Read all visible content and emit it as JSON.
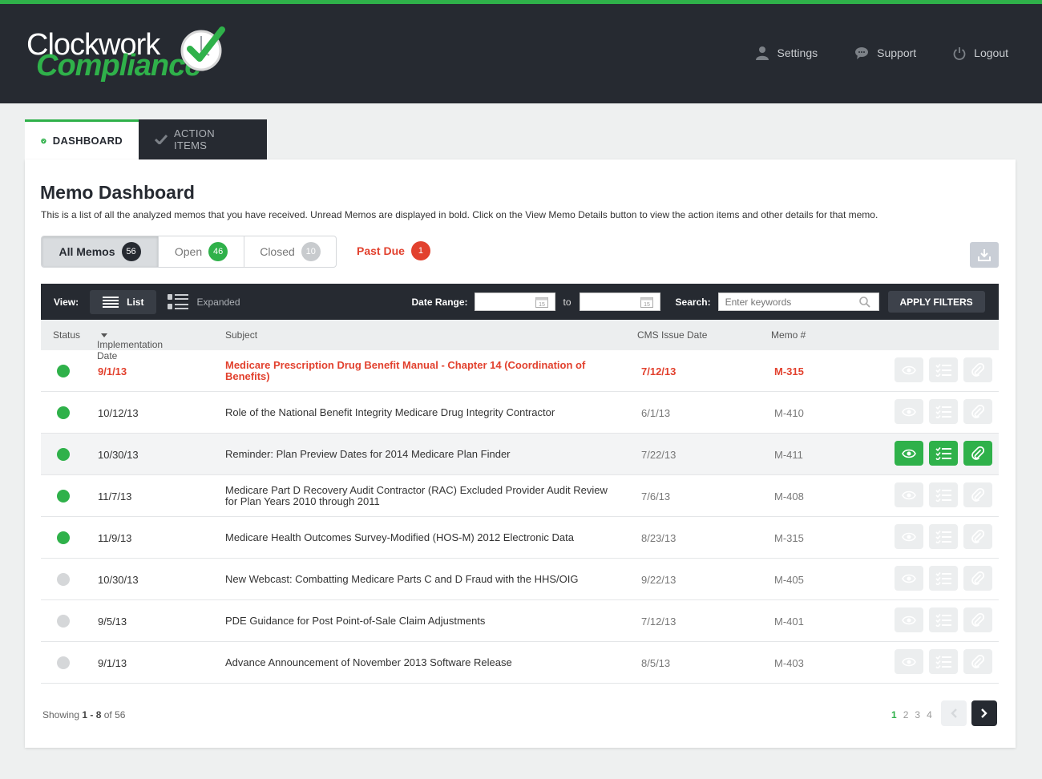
{
  "app": {
    "logo_line1": "Clockwork",
    "logo_line2": "Compliance",
    "accent_color": "#2fb14a",
    "header_color": "#262a31"
  },
  "topnav": {
    "settings": "Settings",
    "support": "Support",
    "logout": "Logout"
  },
  "tabs": {
    "dashboard": "DASHBOARD",
    "action_items": "ACTION ITEMS"
  },
  "page": {
    "title": "Memo Dashboard",
    "description": "This is a list of all the analyzed memos that you have received. Unread Memos are displayed in bold. Click on the View Memo Details button to view the action items and other details for that memo."
  },
  "filters": {
    "all": {
      "label": "All Memos",
      "count": "56"
    },
    "open": {
      "label": "Open",
      "count": "46"
    },
    "closed": {
      "label": "Closed",
      "count": "10"
    },
    "past_due": {
      "label": "Past Due",
      "count": "1"
    }
  },
  "toolbar": {
    "view_label": "View:",
    "list_label": "List",
    "expanded_label": "Expanded",
    "date_range_label": "Date Range:",
    "to_label": "to",
    "calendar_day": "15",
    "search_label": "Search:",
    "search_placeholder": "Enter keywords",
    "apply_label": "APPLY FILTERS"
  },
  "table": {
    "headers": {
      "status": "Status",
      "implementation_date": "Implementation Date",
      "subject": "Subject",
      "cms_issue_date": "CMS Issue Date",
      "memo_no": "Memo #"
    },
    "rows": [
      {
        "status": "green",
        "impl_date": "9/1/13",
        "subject": "Medicare Prescription Drug Benefit Manual - Chapter 14 (Coordination of Benefits)",
        "cms_date": "7/12/13",
        "memo": "M-315",
        "unread": true,
        "highlight": false
      },
      {
        "status": "green",
        "impl_date": "10/12/13",
        "subject": "Role of the National Benefit Integrity Medicare Drug Integrity Contractor",
        "cms_date": "6/1/13",
        "memo": "M-410",
        "unread": false,
        "highlight": false
      },
      {
        "status": "green",
        "impl_date": "10/30/13",
        "subject": "Reminder: Plan Preview Dates for 2014 Medicare Plan Finder",
        "cms_date": "7/22/13",
        "memo": "M-411",
        "unread": false,
        "highlight": true
      },
      {
        "status": "green",
        "impl_date": "11/7/13",
        "subject": "Medicare Part D Recovery Audit Contractor (RAC) Excluded Provider Audit Review for Plan Years 2010 through 2011",
        "cms_date": "7/6/13",
        "memo": "M-408",
        "unread": false,
        "highlight": false
      },
      {
        "status": "green",
        "impl_date": "11/9/13",
        "subject": "Medicare Health Outcomes Survey-Modified (HOS-M) 2012 Electronic Data",
        "cms_date": "8/23/13",
        "memo": "M-315",
        "unread": false,
        "highlight": false
      },
      {
        "status": "gray",
        "impl_date": "10/30/13",
        "subject": "New Webcast: Combatting Medicare Parts C and D Fraud with the HHS/OIG",
        "cms_date": "9/22/13",
        "memo": "M-405",
        "unread": false,
        "highlight": false
      },
      {
        "status": "gray",
        "impl_date": "9/5/13",
        "subject": "PDE Guidance for Post Point-of-Sale Claim Adjustments",
        "cms_date": "7/12/13",
        "memo": "M-401",
        "unread": false,
        "highlight": false
      },
      {
        "status": "gray",
        "impl_date": "9/1/13",
        "subject": "Advance Announcement of November 2013 Software Release",
        "cms_date": "8/5/13",
        "memo": "M-403",
        "unread": false,
        "highlight": false
      }
    ]
  },
  "pagination": {
    "showing_prefix": "Showing",
    "range": "1 - 8",
    "of_label": "of 56",
    "pages": [
      "1",
      "2",
      "3",
      "4"
    ],
    "current_page": "1"
  }
}
